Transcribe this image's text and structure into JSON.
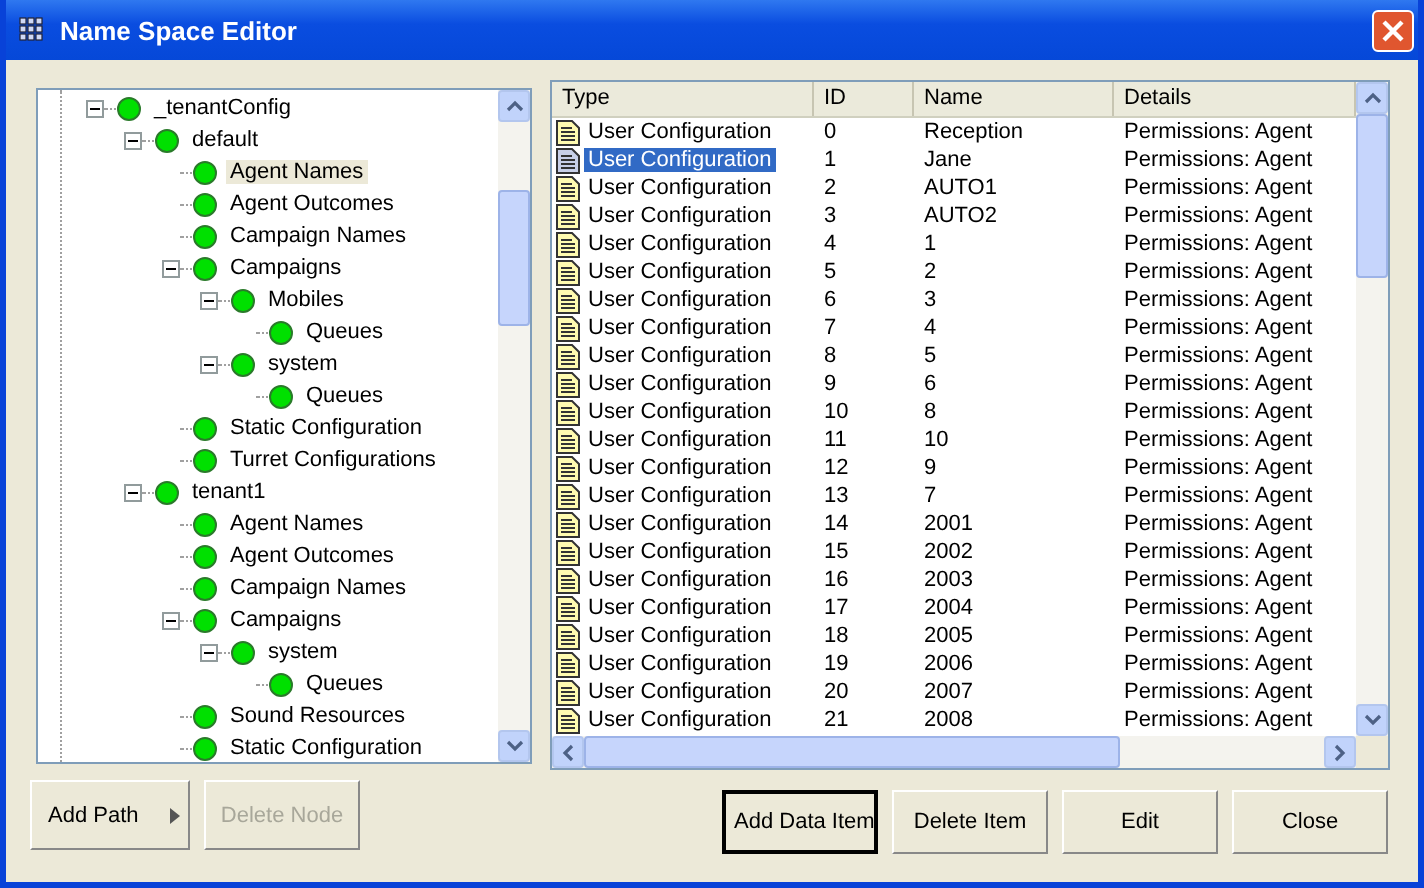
{
  "window": {
    "title": "Name Space Editor"
  },
  "tree": [
    {
      "label": "_tenantConfig",
      "expanded": true,
      "selected": false,
      "children": [
        {
          "label": "default",
          "expanded": true,
          "selected": false,
          "children": [
            {
              "label": "Agent Names",
              "selected": true
            },
            {
              "label": "Agent Outcomes",
              "selected": false
            },
            {
              "label": "Campaign Names",
              "selected": false
            },
            {
              "label": "Campaigns",
              "expanded": true,
              "selected": false,
              "children": [
                {
                  "label": "Mobiles",
                  "expanded": true,
                  "selected": false,
                  "children": [
                    {
                      "label": "Queues",
                      "selected": false
                    }
                  ]
                },
                {
                  "label": "system",
                  "expanded": true,
                  "selected": false,
                  "children": [
                    {
                      "label": "Queues",
                      "selected": false
                    }
                  ]
                }
              ]
            },
            {
              "label": "Static Configuration",
              "selected": false
            },
            {
              "label": "Turret Configurations",
              "selected": false
            }
          ]
        },
        {
          "label": "tenant1",
          "expanded": true,
          "selected": false,
          "children": [
            {
              "label": "Agent Names",
              "selected": false
            },
            {
              "label": "Agent Outcomes",
              "selected": false
            },
            {
              "label": "Campaign Names",
              "selected": false
            },
            {
              "label": "Campaigns",
              "expanded": true,
              "selected": false,
              "children": [
                {
                  "label": "system",
                  "expanded": true,
                  "selected": false,
                  "children": [
                    {
                      "label": "Queues",
                      "selected": false
                    }
                  ]
                }
              ]
            },
            {
              "label": "Sound Resources",
              "selected": false
            },
            {
              "label": "Static Configuration",
              "selected": false
            }
          ]
        }
      ]
    }
  ],
  "table": {
    "columns": [
      "Type",
      "ID",
      "Name",
      "Details"
    ],
    "rows": [
      {
        "type": "User Configuration",
        "id": "0",
        "name": "Reception",
        "details": "Permissions: Agent",
        "selected": false
      },
      {
        "type": "User Configuration",
        "id": "1",
        "name": "Jane",
        "details": "Permissions: Agent",
        "selected": true
      },
      {
        "type": "User Configuration",
        "id": "2",
        "name": "AUTO1",
        "details": "Permissions: Agent",
        "selected": false
      },
      {
        "type": "User Configuration",
        "id": "3",
        "name": "AUTO2",
        "details": "Permissions: Agent",
        "selected": false
      },
      {
        "type": "User Configuration",
        "id": "4",
        "name": "1",
        "details": "Permissions: Agent",
        "selected": false
      },
      {
        "type": "User Configuration",
        "id": "5",
        "name": "2",
        "details": "Permissions: Agent",
        "selected": false
      },
      {
        "type": "User Configuration",
        "id": "6",
        "name": "3",
        "details": "Permissions: Agent",
        "selected": false
      },
      {
        "type": "User Configuration",
        "id": "7",
        "name": "4",
        "details": "Permissions: Agent",
        "selected": false
      },
      {
        "type": "User Configuration",
        "id": "8",
        "name": "5",
        "details": "Permissions: Agent",
        "selected": false
      },
      {
        "type": "User Configuration",
        "id": "9",
        "name": "6",
        "details": "Permissions: Agent",
        "selected": false
      },
      {
        "type": "User Configuration",
        "id": "10",
        "name": "8",
        "details": "Permissions: Agent",
        "selected": false
      },
      {
        "type": "User Configuration",
        "id": "11",
        "name": "10",
        "details": "Permissions: Agent",
        "selected": false
      },
      {
        "type": "User Configuration",
        "id": "12",
        "name": "9",
        "details": "Permissions: Agent",
        "selected": false
      },
      {
        "type": "User Configuration",
        "id": "13",
        "name": "7",
        "details": "Permissions: Agent",
        "selected": false
      },
      {
        "type": "User Configuration",
        "id": "14",
        "name": "2001",
        "details": "Permissions: Agent",
        "selected": false
      },
      {
        "type": "User Configuration",
        "id": "15",
        "name": "2002",
        "details": "Permissions: Agent",
        "selected": false
      },
      {
        "type": "User Configuration",
        "id": "16",
        "name": "2003",
        "details": "Permissions: Agent",
        "selected": false
      },
      {
        "type": "User Configuration",
        "id": "17",
        "name": "2004",
        "details": "Permissions: Agent",
        "selected": false
      },
      {
        "type": "User Configuration",
        "id": "18",
        "name": "2005",
        "details": "Permissions: Agent",
        "selected": false
      },
      {
        "type": "User Configuration",
        "id": "19",
        "name": "2006",
        "details": "Permissions: Agent",
        "selected": false
      },
      {
        "type": "User Configuration",
        "id": "20",
        "name": "2007",
        "details": "Permissions: Agent",
        "selected": false
      },
      {
        "type": "User Configuration",
        "id": "21",
        "name": "2008",
        "details": "Permissions: Agent",
        "selected": false
      }
    ]
  },
  "left_buttons": [
    {
      "label": "Add Path",
      "kind": "menu",
      "disabled": false
    },
    {
      "label": "Delete Node",
      "kind": "plain",
      "disabled": true
    }
  ],
  "right_buttons": [
    {
      "label": "Add Data Item",
      "default": true
    },
    {
      "label": "Delete Item",
      "default": false
    },
    {
      "label": "Edit",
      "default": false
    },
    {
      "label": "Close",
      "default": false
    }
  ]
}
